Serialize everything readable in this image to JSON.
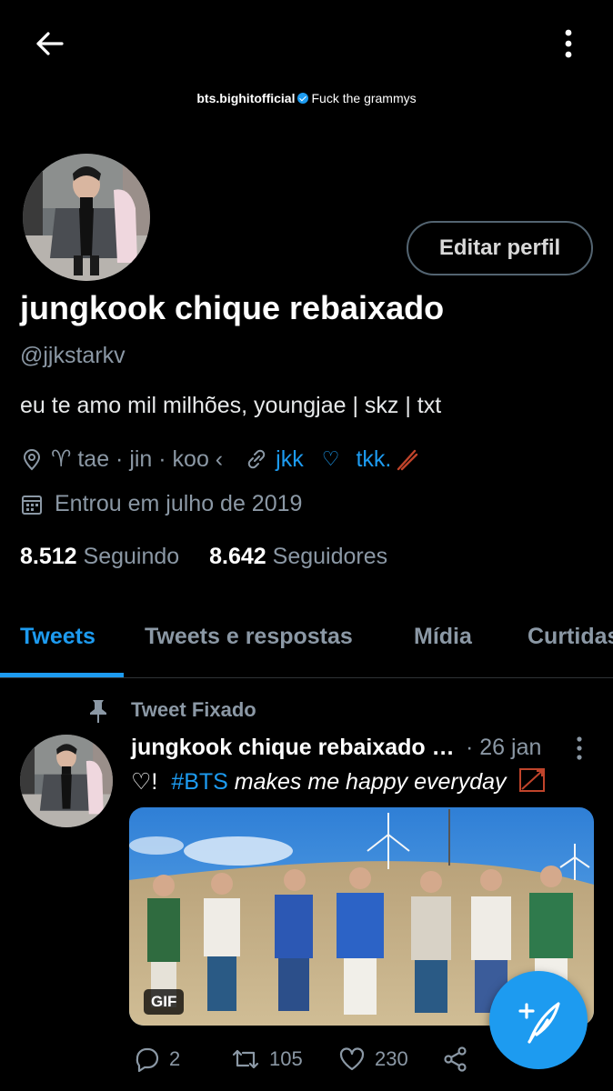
{
  "header": {
    "back_icon": "arrow-left-icon",
    "more_icon": "more-vertical-icon"
  },
  "banner": {
    "username": "bts.bighitofficial",
    "motto": "Fuck the grammys"
  },
  "profile": {
    "edit_label": "Editar perfil",
    "name": "jungkook chique rebaixado",
    "handle": "@jjkstarkv",
    "bio": "eu te amo mil milhões, youngjae | skz | txt",
    "location": "♈ tae · jin · koo ‹",
    "link_text": "jkk",
    "heart": "♡",
    "extra": "tkk.",
    "joined": "Entrou em julho de 2019",
    "following_count": "8.512",
    "following_label": "Seguindo",
    "followers_count": "8.642",
    "followers_label": "Seguidores"
  },
  "tabs": [
    {
      "label": "Tweets",
      "active": true
    },
    {
      "label": "Tweets e respostas",
      "active": false
    },
    {
      "label": "Mídia",
      "active": false
    },
    {
      "label": "Curtidas",
      "active": false
    }
  ],
  "tweet": {
    "pinned_label": "Tweet Fixado",
    "author": "jungkook chique rebaixado …",
    "date": "· 26 jan",
    "text_prefix": "♡!",
    "hashtag": "#BTS",
    "text_rest": "makes me happy everyday",
    "media_badge": "GIF",
    "replies": "2",
    "retweets": "105",
    "likes": "230"
  },
  "colors": {
    "accent": "#1d9bf0",
    "background": "#000000",
    "secondary_text": "#8b98a5"
  }
}
